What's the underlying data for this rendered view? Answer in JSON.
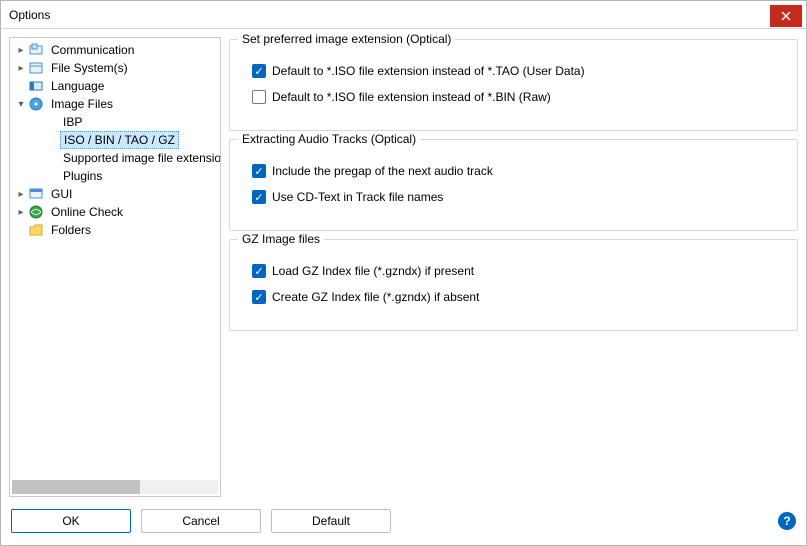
{
  "window": {
    "title": "Options"
  },
  "tree": {
    "communication": "Communication",
    "file_system": "File System(s)",
    "language": "Language",
    "image_files": "Image Files",
    "ibp": "IBP",
    "iso_bin_tao_gz": "ISO / BIN / TAO / GZ",
    "supported_ext": "Supported image file extension",
    "plugins": "Plugins",
    "gui": "GUI",
    "online_check": "Online Check",
    "folders": "Folders"
  },
  "groups": {
    "preferred": {
      "title": "Set preferred image extension (Optical)",
      "opt_tao": "Default to *.ISO file extension instead of *.TAO (User Data)",
      "opt_bin": "Default to *.ISO file extension instead of *.BIN (Raw)"
    },
    "extract": {
      "title": "Extracting Audio Tracks (Optical)",
      "opt_pregap": "Include the pregap of the next audio track",
      "opt_cdtext": "Use CD-Text in Track file names"
    },
    "gz": {
      "title": "GZ Image files",
      "opt_load": "Load GZ Index file (*.gzndx) if present",
      "opt_create": "Create GZ Index file (*.gzndx) if absent"
    }
  },
  "buttons": {
    "ok": "OK",
    "cancel": "Cancel",
    "default": "Default"
  }
}
